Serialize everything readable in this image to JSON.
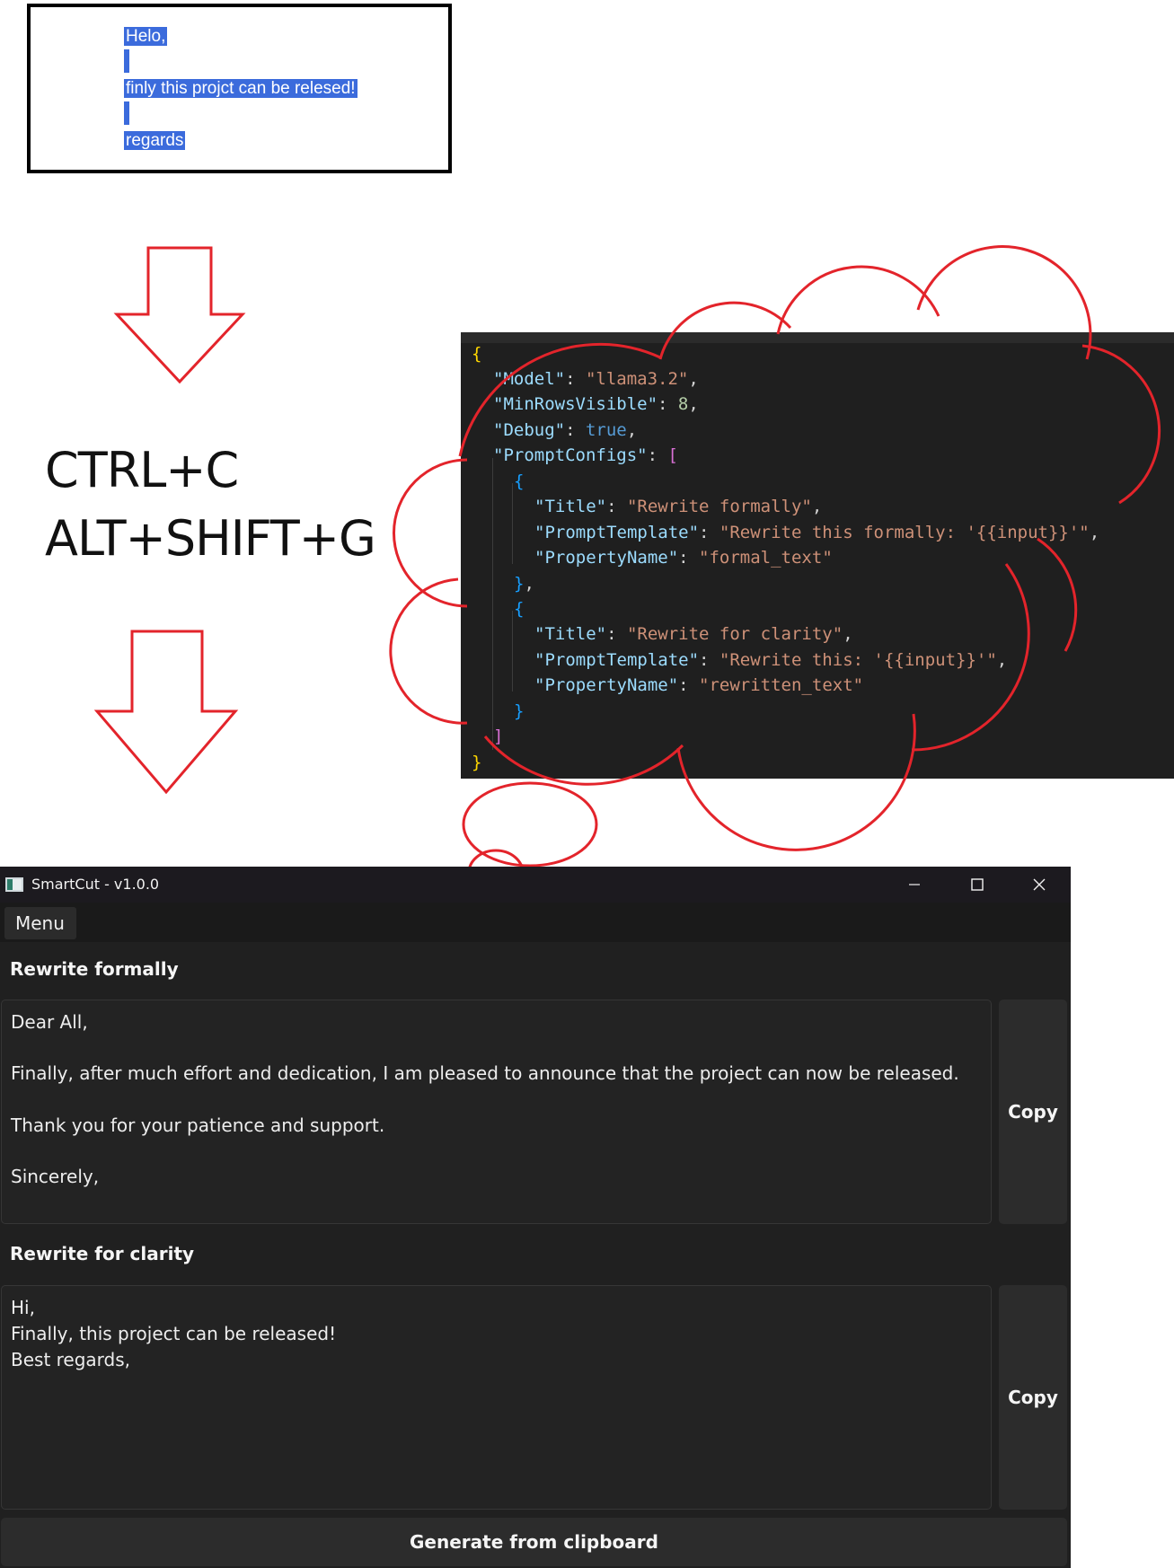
{
  "source_text": {
    "lines": [
      "Helo,",
      "finly this projct can be relesed!",
      "regards"
    ]
  },
  "hotkeys": {
    "copy": "CTRL+C",
    "generate": "ALT+SHIFT+G"
  },
  "config_json": {
    "model_key": "\"Model\"",
    "model_value": "\"llama3.2\"",
    "min_rows_key": "\"MinRowsVisible\"",
    "min_rows_value": "8",
    "debug_key": "\"Debug\"",
    "debug_value": "true",
    "prompt_configs_key": "\"PromptConfigs\"",
    "configs": [
      {
        "title_key": "\"Title\"",
        "title_value": "\"Rewrite formally\"",
        "template_key": "\"PromptTemplate\"",
        "template_value": "\"Rewrite this formally: '{{input}}'\"",
        "property_key": "\"PropertyName\"",
        "property_value": "\"formal_text\""
      },
      {
        "title_key": "\"Title\"",
        "title_value": "\"Rewrite for clarity\"",
        "template_key": "\"PromptTemplate\"",
        "template_value": "\"Rewrite this: '{{input}}'\"",
        "property_key": "\"PropertyName\"",
        "property_value": "\"rewritten_text\""
      }
    ]
  },
  "app": {
    "title": "SmartCut - v1.0.0",
    "menu_label": "Menu",
    "sections": [
      {
        "title": "Rewrite formally",
        "output_lines": [
          "Dear All,",
          "",
          "Finally, after much effort and dedication, I am pleased to announce that the project can now be released.",
          "",
          "Thank you for your patience and support.",
          "",
          "Sincerely,"
        ],
        "copy_label": "Copy"
      },
      {
        "title": "Rewrite for clarity",
        "output_lines": [
          "Hi,",
          "Finally, this project can be released!",
          "Best regards,"
        ],
        "copy_label": "Copy"
      }
    ],
    "generate_label": "Generate from clipboard"
  },
  "colors": {
    "selection": "#3b6bdc",
    "annotation": "#e3242b",
    "app_background": "#202020"
  },
  "icons": [
    "app-icon",
    "minimize-icon",
    "maximize-icon",
    "close-icon",
    "arrow-down-icon",
    "thought-cloud"
  ]
}
